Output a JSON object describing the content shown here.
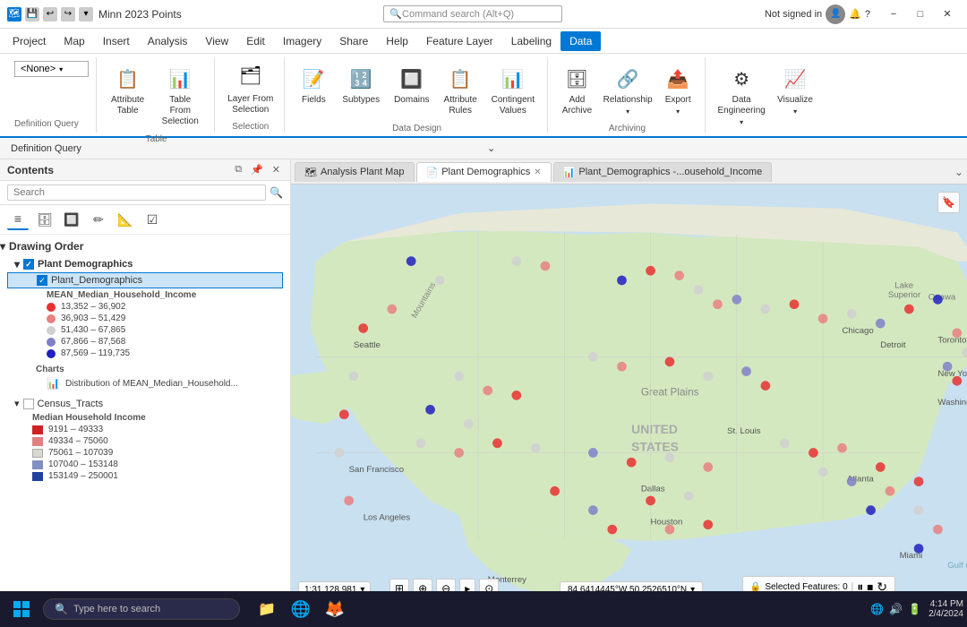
{
  "titlebar": {
    "title": "Minn 2023 Points",
    "search_placeholder": "Command search (Alt+Q)",
    "not_signed_in": "Not signed in",
    "help": "?",
    "minimize": "−",
    "restore": "□",
    "close": "✕"
  },
  "menubar": {
    "items": [
      "Project",
      "Map",
      "Insert",
      "Analysis",
      "View",
      "Edit",
      "Imagery",
      "Share",
      "Help",
      "Feature Layer",
      "Labeling",
      "Data"
    ]
  },
  "ribbon": {
    "active_tab": "Data",
    "def_query_label": "Definition Query",
    "groups": [
      {
        "name": "definition-query-group",
        "label": "",
        "items": [
          {
            "id": "none-dropdown",
            "label": "<None>",
            "type": "dropdown"
          }
        ]
      },
      {
        "name": "table-group",
        "label": "Table",
        "items": [
          {
            "id": "attribute-table",
            "icon": "📋",
            "label": "Attribute\nTable"
          },
          {
            "id": "table-from-selection",
            "icon": "📊",
            "label": "Table From\nSelection"
          }
        ]
      },
      {
        "name": "selection-group",
        "label": "Selection",
        "items": [
          {
            "id": "layer-from-selection",
            "icon": "🗂",
            "label": "Layer From\nSelection"
          }
        ]
      },
      {
        "name": "data-design-group",
        "label": "Data Design",
        "items": [
          {
            "id": "fields",
            "icon": "📝",
            "label": "Fields"
          },
          {
            "id": "subtypes",
            "icon": "🔢",
            "label": "Subtypes"
          },
          {
            "id": "domains",
            "icon": "🔲",
            "label": "Domains"
          },
          {
            "id": "attribute-rules",
            "icon": "📋",
            "label": "Attribute\nRules"
          },
          {
            "id": "contingent-values",
            "icon": "📊",
            "label": "Contingent\nValues"
          }
        ]
      },
      {
        "name": "archiving-group",
        "label": "Archiving",
        "items": [
          {
            "id": "add-archive",
            "icon": "🗄",
            "label": "Add\nArchive"
          },
          {
            "id": "relationship",
            "icon": "🔗",
            "label": "Relationship"
          },
          {
            "id": "export",
            "icon": "📤",
            "label": "Export"
          }
        ]
      },
      {
        "name": "engineering-group",
        "label": "",
        "items": [
          {
            "id": "data-engineering",
            "icon": "⚙",
            "label": "Data\nEngineering"
          },
          {
            "id": "visualize",
            "icon": "📈",
            "label": "Visualize"
          }
        ]
      }
    ]
  },
  "contents": {
    "title": "Contents",
    "search_placeholder": "Search",
    "tools": [
      "list-by-drawing-order",
      "list-by-source",
      "list-by-type",
      "list-by-editing",
      "list-by-snapping",
      "list-by-selection"
    ],
    "drawing_order_label": "Drawing Order",
    "layers": [
      {
        "name": "Plant Demographics",
        "type": "group",
        "children": [
          {
            "name": "Plant_Demographics",
            "type": "layer",
            "selected": true,
            "legend_title": "MEAN_Median_Household_Income",
            "legend": [
              {
                "color": "#e83030",
                "range": "13,352 – 36,902"
              },
              {
                "color": "#e88080",
                "range": "36,903 – 51,429"
              },
              {
                "color": "#d0d0d0",
                "range": "51,430 – 67,865"
              },
              {
                "color": "#8080c8",
                "range": "67,866 – 87,568"
              },
              {
                "color": "#2020c0",
                "range": "87,569 – 119,735"
              }
            ],
            "charts_label": "Charts",
            "charts": [
              {
                "icon": "📊",
                "label": "Distribution of MEAN_Median_Household..."
              }
            ]
          }
        ]
      },
      {
        "name": "Census_Tracts",
        "type": "layer",
        "selected": false,
        "legend_title": "Median Household Income",
        "legend": [
          {
            "color": "#cc2222",
            "range": "9191 – 49333"
          },
          {
            "color": "#e08080",
            "range": "49334 – 75060"
          },
          {
            "color": "#d8d8d0",
            "range": "75061 – 107039"
          },
          {
            "color": "#8090c0",
            "range": "107040 – 153148"
          },
          {
            "color": "#2040a0",
            "range": "153149 – 250001"
          }
        ]
      }
    ]
  },
  "map_tabs": [
    {
      "id": "analysis-plant-map",
      "label": "Analysis Plant Map",
      "icon": "🗺",
      "active": false,
      "closeable": false
    },
    {
      "id": "plant-demographics",
      "label": "Plant Demographics",
      "icon": "📄",
      "active": true,
      "closeable": true
    },
    {
      "id": "plant-demographics-chart",
      "label": "Plant_Demographics -...ousehold_Income",
      "icon": "📊",
      "active": false,
      "closeable": false
    }
  ],
  "status_bar": {
    "scale": "1:31,128,981",
    "coordinates": "84.6414445°W 50.2526510°N",
    "selected_features": "Selected Features: 0"
  },
  "taskbar": {
    "search_placeholder": "Type here to search",
    "time": "4:14 PM",
    "date": "2/4/2024"
  },
  "map_points": [
    {
      "x": 52,
      "y": 18,
      "color": "#2020c0"
    },
    {
      "x": 37,
      "y": 42,
      "color": "#d0d0d0"
    },
    {
      "x": 31,
      "y": 54,
      "color": "#e88080"
    },
    {
      "x": 19,
      "y": 38,
      "color": "#e83030"
    },
    {
      "x": 30,
      "y": 30,
      "color": "#d0d0d0"
    },
    {
      "x": 46,
      "y": 22,
      "color": "#e88080"
    },
    {
      "x": 55,
      "y": 30,
      "color": "#2020c0"
    },
    {
      "x": 60,
      "y": 35,
      "color": "#e83030"
    },
    {
      "x": 58,
      "y": 42,
      "color": "#e88080"
    },
    {
      "x": 70,
      "y": 20,
      "color": "#8080c8"
    },
    {
      "x": 72,
      "y": 28,
      "color": "#d0d0d0"
    },
    {
      "x": 75,
      "y": 32,
      "color": "#e83030"
    },
    {
      "x": 78,
      "y": 25,
      "color": "#e88080"
    },
    {
      "x": 80,
      "y": 38,
      "color": "#d0d0d0"
    },
    {
      "x": 83,
      "y": 18,
      "color": "#2020c0"
    },
    {
      "x": 85,
      "y": 30,
      "color": "#e88080"
    },
    {
      "x": 87,
      "y": 22,
      "color": "#d0d0d0"
    },
    {
      "x": 90,
      "y": 35,
      "color": "#8080c8"
    },
    {
      "x": 92,
      "y": 28,
      "color": "#e83030"
    },
    {
      "x": 94,
      "y": 18,
      "color": "#2020c0"
    },
    {
      "x": 65,
      "y": 45,
      "color": "#d0d0d0"
    },
    {
      "x": 68,
      "y": 52,
      "color": "#e88080"
    },
    {
      "x": 72,
      "y": 48,
      "color": "#e83030"
    },
    {
      "x": 75,
      "y": 55,
      "color": "#d0d0d0"
    },
    {
      "x": 78,
      "y": 62,
      "color": "#8080c8"
    },
    {
      "x": 80,
      "y": 50,
      "color": "#e83030"
    },
    {
      "x": 82,
      "y": 58,
      "color": "#e88080"
    },
    {
      "x": 85,
      "y": 48,
      "color": "#d0d0d0"
    },
    {
      "x": 88,
      "y": 55,
      "color": "#e83030"
    },
    {
      "x": 90,
      "y": 62,
      "color": "#2020c0"
    },
    {
      "x": 92,
      "y": 50,
      "color": "#e88080"
    },
    {
      "x": 55,
      "y": 58,
      "color": "#d0d0d0"
    },
    {
      "x": 48,
      "y": 65,
      "color": "#e88080"
    },
    {
      "x": 52,
      "y": 72,
      "color": "#e83030"
    },
    {
      "x": 60,
      "y": 68,
      "color": "#d0d0d0"
    },
    {
      "x": 65,
      "y": 75,
      "color": "#2020c0"
    },
    {
      "x": 70,
      "y": 70,
      "color": "#e83030"
    },
    {
      "x": 75,
      "y": 78,
      "color": "#d0d0d0"
    },
    {
      "x": 80,
      "y": 72,
      "color": "#e88080"
    },
    {
      "x": 82,
      "y": 80,
      "color": "#e83030"
    },
    {
      "x": 85,
      "y": 68,
      "color": "#8080c8"
    },
    {
      "x": 88,
      "y": 75,
      "color": "#e83030"
    },
    {
      "x": 90,
      "y": 70,
      "color": "#2020c0"
    },
    {
      "x": 40,
      "y": 55,
      "color": "#d0d0d0"
    },
    {
      "x": 35,
      "y": 65,
      "color": "#e88080"
    },
    {
      "x": 42,
      "y": 75,
      "color": "#e83030"
    },
    {
      "x": 38,
      "y": 80,
      "color": "#d0d0d0"
    },
    {
      "x": 45,
      "y": 85,
      "color": "#8080c8"
    },
    {
      "x": 50,
      "y": 80,
      "color": "#e83030"
    },
    {
      "x": 58,
      "y": 85,
      "color": "#e88080"
    }
  ]
}
